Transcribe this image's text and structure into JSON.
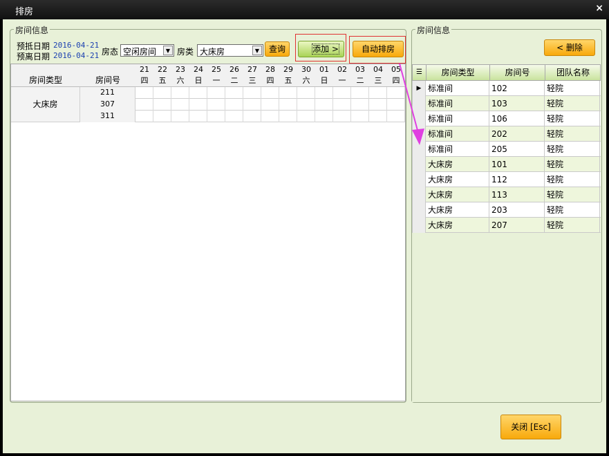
{
  "window": {
    "title": "排房",
    "close_label": "×"
  },
  "left_group": {
    "caption": "房间信息",
    "arrive_label": "预抵日期",
    "arrive_date": "2016-04-21",
    "depart_label": "预离日期",
    "depart_date": "2016-04-21",
    "status_label": "房态",
    "status_value": "空闲房间",
    "type_label": "房类",
    "type_value": "大床房",
    "query_button": "查询",
    "add_button": "添加 >",
    "auto_button": "自动排房"
  },
  "left_grid": {
    "col_room_type": "房间类型",
    "col_room_no": "房间号",
    "dates": [
      {
        "day": "21",
        "weekday": "四"
      },
      {
        "day": "22",
        "weekday": "五"
      },
      {
        "day": "23",
        "weekday": "六"
      },
      {
        "day": "24",
        "weekday": "日"
      },
      {
        "day": "25",
        "weekday": "一"
      },
      {
        "day": "26",
        "weekday": "二"
      },
      {
        "day": "27",
        "weekday": "三"
      },
      {
        "day": "28",
        "weekday": "四"
      },
      {
        "day": "29",
        "weekday": "五"
      },
      {
        "day": "30",
        "weekday": "六"
      },
      {
        "day": "01",
        "weekday": "日"
      },
      {
        "day": "02",
        "weekday": "一"
      },
      {
        "day": "03",
        "weekday": "二"
      },
      {
        "day": "04",
        "weekday": "三"
      },
      {
        "day": "05",
        "weekday": "四"
      }
    ],
    "room_type": "大床房",
    "rooms": [
      "211",
      "307",
      "311"
    ]
  },
  "right_group": {
    "caption": "房间信息",
    "delete_button": "< 删除",
    "col_room_type": "房间类型",
    "col_room_no": "房间号",
    "col_team": "团队名称",
    "current_marker": "▶",
    "rows": [
      {
        "type": "标准间",
        "no": "102",
        "team": "轻院"
      },
      {
        "type": "标准间",
        "no": "103",
        "team": "轻院"
      },
      {
        "type": "标准间",
        "no": "106",
        "team": "轻院"
      },
      {
        "type": "标准间",
        "no": "202",
        "team": "轻院"
      },
      {
        "type": "标准间",
        "no": "205",
        "team": "轻院"
      },
      {
        "type": "大床房",
        "no": "101",
        "team": "轻院"
      },
      {
        "type": "大床房",
        "no": "112",
        "team": "轻院"
      },
      {
        "type": "大床房",
        "no": "113",
        "team": "轻院"
      },
      {
        "type": "大床房",
        "no": "203",
        "team": "轻院"
      },
      {
        "type": "大床房",
        "no": "207",
        "team": "轻院"
      }
    ]
  },
  "footer": {
    "close_button": "关闭 [Esc]"
  },
  "colors": {
    "accent_orange": "#f8a90b",
    "accent_green": "#a9d356",
    "annotation_red": "#e03030",
    "annotation_arrow": "#e040e0"
  }
}
